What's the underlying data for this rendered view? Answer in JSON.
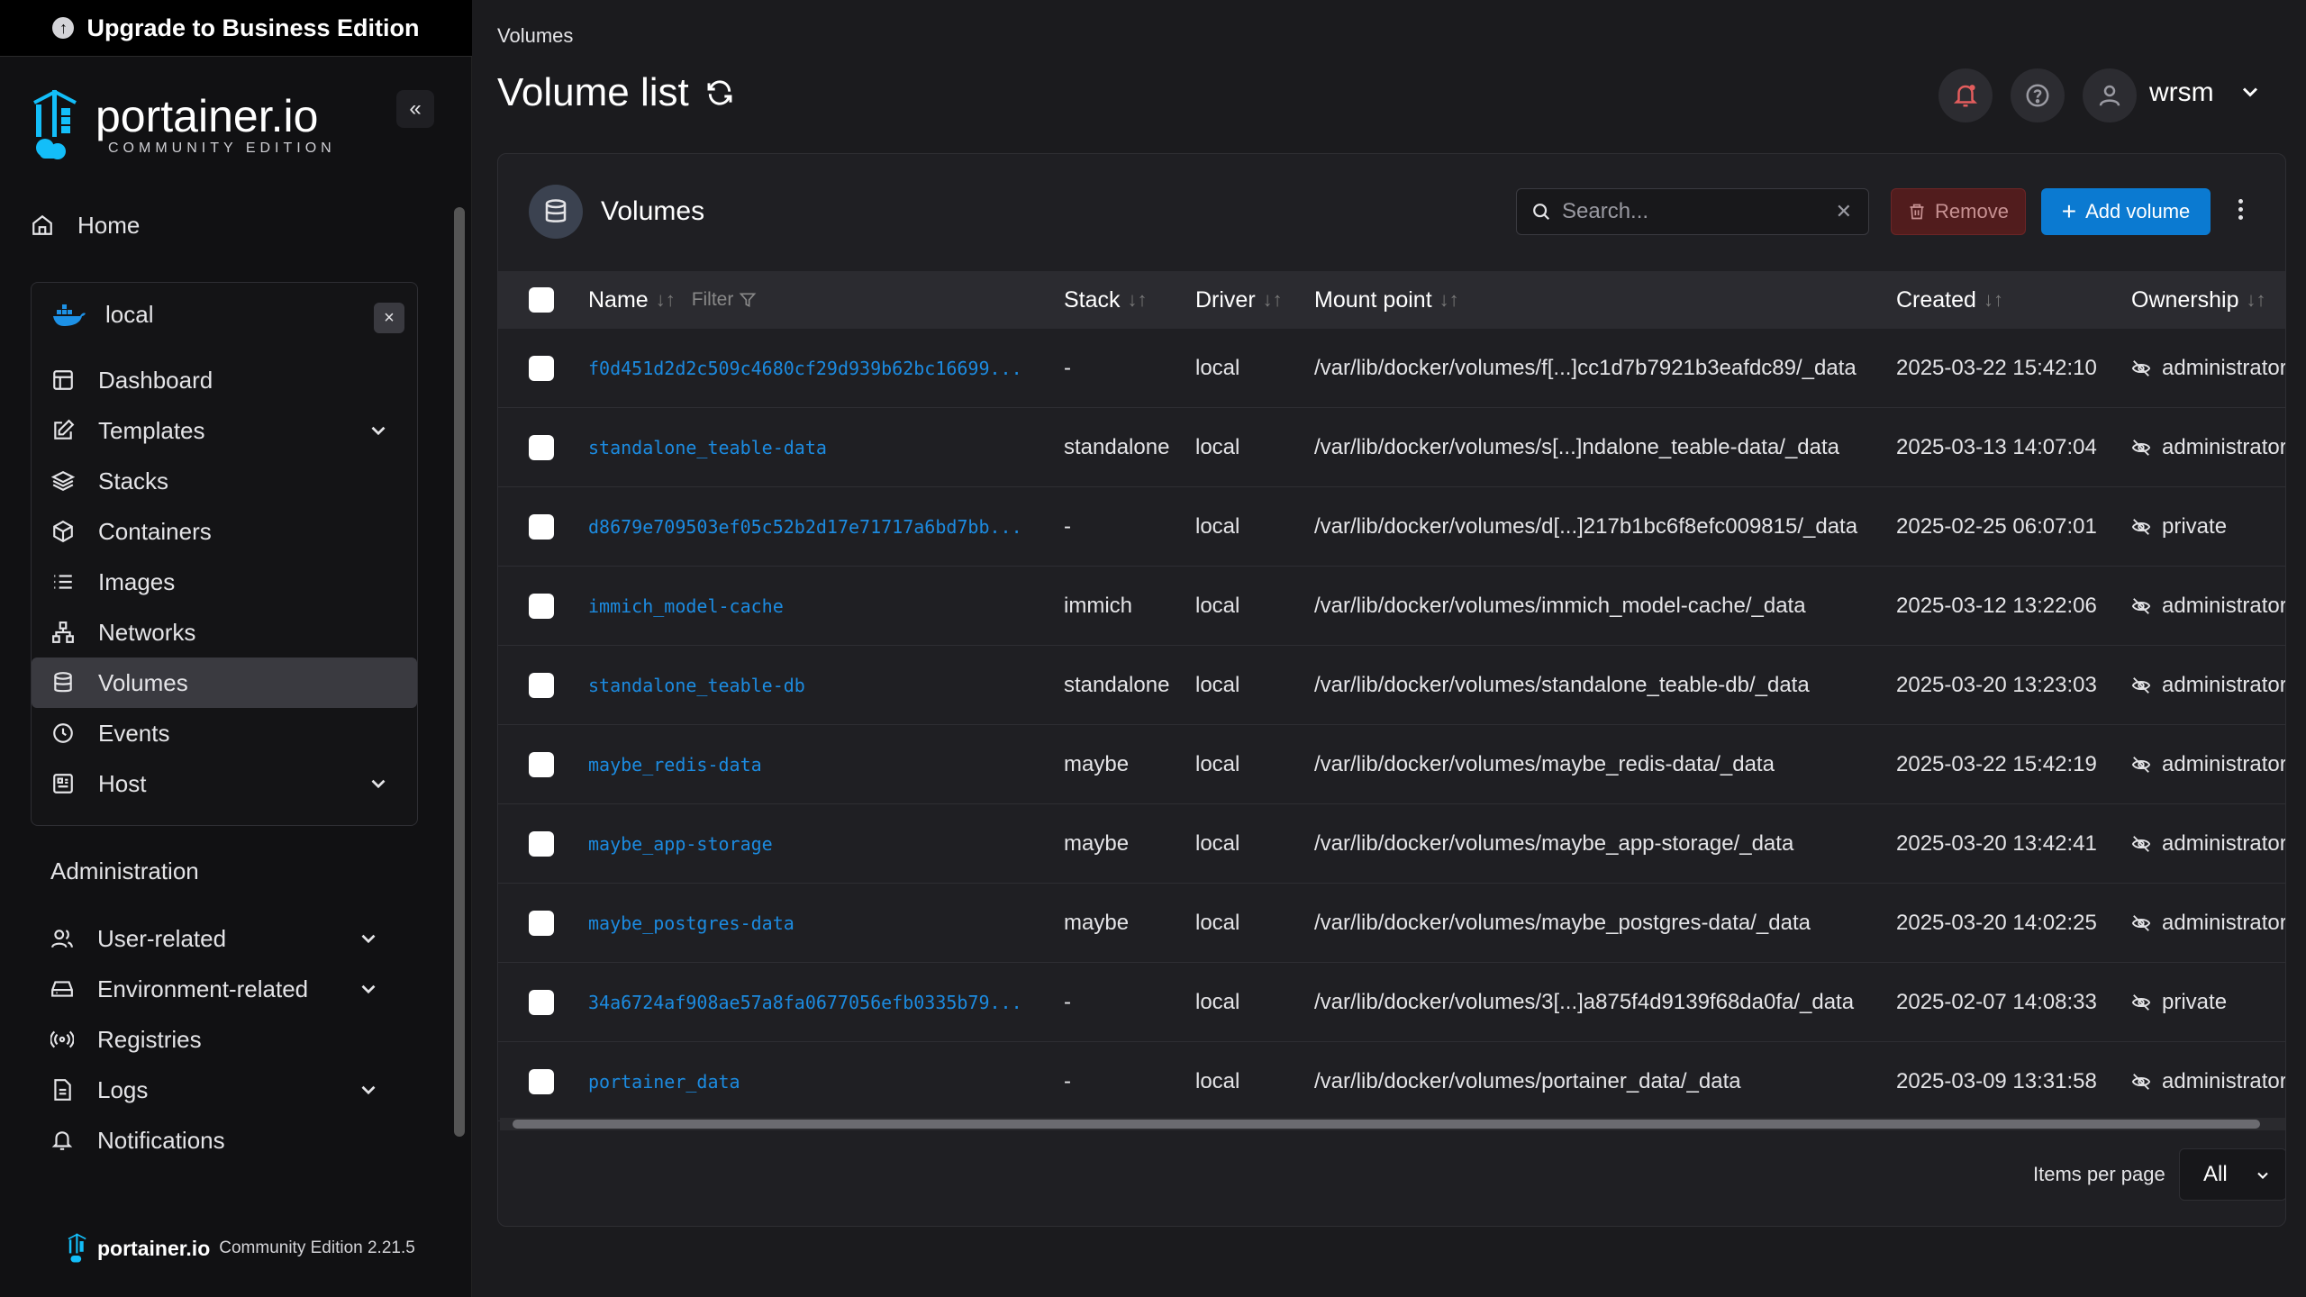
{
  "upgrade": {
    "label": "Upgrade to Business Edition"
  },
  "logo": {
    "name": "portainer.io",
    "sub": "COMMUNITY EDITION"
  },
  "nav": {
    "home": "Home"
  },
  "environment": {
    "name": "local",
    "items": [
      {
        "label": "Dashboard",
        "icon": "dashboard-icon",
        "expand": false
      },
      {
        "label": "Templates",
        "icon": "edit-icon",
        "expand": true
      },
      {
        "label": "Stacks",
        "icon": "layers-icon",
        "expand": false
      },
      {
        "label": "Containers",
        "icon": "box-icon",
        "expand": false
      },
      {
        "label": "Images",
        "icon": "list-icon",
        "expand": false
      },
      {
        "label": "Networks",
        "icon": "network-icon",
        "expand": false
      },
      {
        "label": "Volumes",
        "icon": "database-icon",
        "expand": false,
        "active": true
      },
      {
        "label": "Events",
        "icon": "clock-icon",
        "expand": false
      },
      {
        "label": "Host",
        "icon": "server-icon",
        "expand": true
      }
    ]
  },
  "administration": {
    "title": "Administration",
    "items": [
      {
        "label": "User-related",
        "icon": "users-icon",
        "expand": true
      },
      {
        "label": "Environment-related",
        "icon": "hdd-icon",
        "expand": true
      },
      {
        "label": "Registries",
        "icon": "radio-icon",
        "expand": false
      },
      {
        "label": "Logs",
        "icon": "file-icon",
        "expand": true
      },
      {
        "label": "Notifications",
        "icon": "bell-icon",
        "expand": false
      }
    ]
  },
  "footer": {
    "name": "portainer.io",
    "edition": "Community Edition 2.21.5"
  },
  "header": {
    "breadcrumb": "Volumes",
    "title": "Volume list",
    "user": "wrsm"
  },
  "panel": {
    "title": "Volumes",
    "search_placeholder": "Search...",
    "remove_label": "Remove",
    "add_label": "Add volume",
    "columns": {
      "name": "Name",
      "filter": "Filter",
      "stack": "Stack",
      "driver": "Driver",
      "mount": "Mount point",
      "created": "Created",
      "ownership": "Ownership"
    },
    "rows": [
      {
        "name": "f0d451d2d2c509c4680cf29d939b62bc16699...",
        "stack": "-",
        "driver": "local",
        "mount": "/var/lib/docker/volumes/f[...]cc1d7b7921b3eafdc89/_data",
        "created": "2025-03-22 15:42:10",
        "ownership": "administrators"
      },
      {
        "name": "standalone_teable-data",
        "stack": "standalone",
        "driver": "local",
        "mount": "/var/lib/docker/volumes/s[...]ndalone_teable-data/_data",
        "created": "2025-03-13 14:07:04",
        "ownership": "administrators"
      },
      {
        "name": "d8679e709503ef05c52b2d17e71717a6bd7bb...",
        "stack": "-",
        "driver": "local",
        "mount": "/var/lib/docker/volumes/d[...]217b1bc6f8efc009815/_data",
        "created": "2025-02-25 06:07:01",
        "ownership": "private"
      },
      {
        "name": "immich_model-cache",
        "stack": "immich",
        "driver": "local",
        "mount": "/var/lib/docker/volumes/immich_model-cache/_data",
        "created": "2025-03-12 13:22:06",
        "ownership": "administrators"
      },
      {
        "name": "standalone_teable-db",
        "stack": "standalone",
        "driver": "local",
        "mount": "/var/lib/docker/volumes/standalone_teable-db/_data",
        "created": "2025-03-20 13:23:03",
        "ownership": "administrators"
      },
      {
        "name": "maybe_redis-data",
        "stack": "maybe",
        "driver": "local",
        "mount": "/var/lib/docker/volumes/maybe_redis-data/_data",
        "created": "2025-03-22 15:42:19",
        "ownership": "administrators"
      },
      {
        "name": "maybe_app-storage",
        "stack": "maybe",
        "driver": "local",
        "mount": "/var/lib/docker/volumes/maybe_app-storage/_data",
        "created": "2025-03-20 13:42:41",
        "ownership": "administrators"
      },
      {
        "name": "maybe_postgres-data",
        "stack": "maybe",
        "driver": "local",
        "mount": "/var/lib/docker/volumes/maybe_postgres-data/_data",
        "created": "2025-03-20 14:02:25",
        "ownership": "administrators"
      },
      {
        "name": "34a6724af908ae57a8fa0677056efb0335b79...",
        "stack": "-",
        "driver": "local",
        "mount": "/var/lib/docker/volumes/3[...]a875f4d9139f68da0fa/_data",
        "created": "2025-02-07 14:08:33",
        "ownership": "private"
      },
      {
        "name": "portainer_data",
        "stack": "-",
        "driver": "local",
        "mount": "/var/lib/docker/volumes/portainer_data/_data",
        "created": "2025-03-09 13:31:58",
        "ownership": "administrators"
      }
    ],
    "items_per_page_label": "Items per page",
    "items_per_page_value": "All"
  },
  "colors": {
    "accent": "#0b7ad1",
    "link": "#1c8be0",
    "danger": "#5b1d1d"
  }
}
